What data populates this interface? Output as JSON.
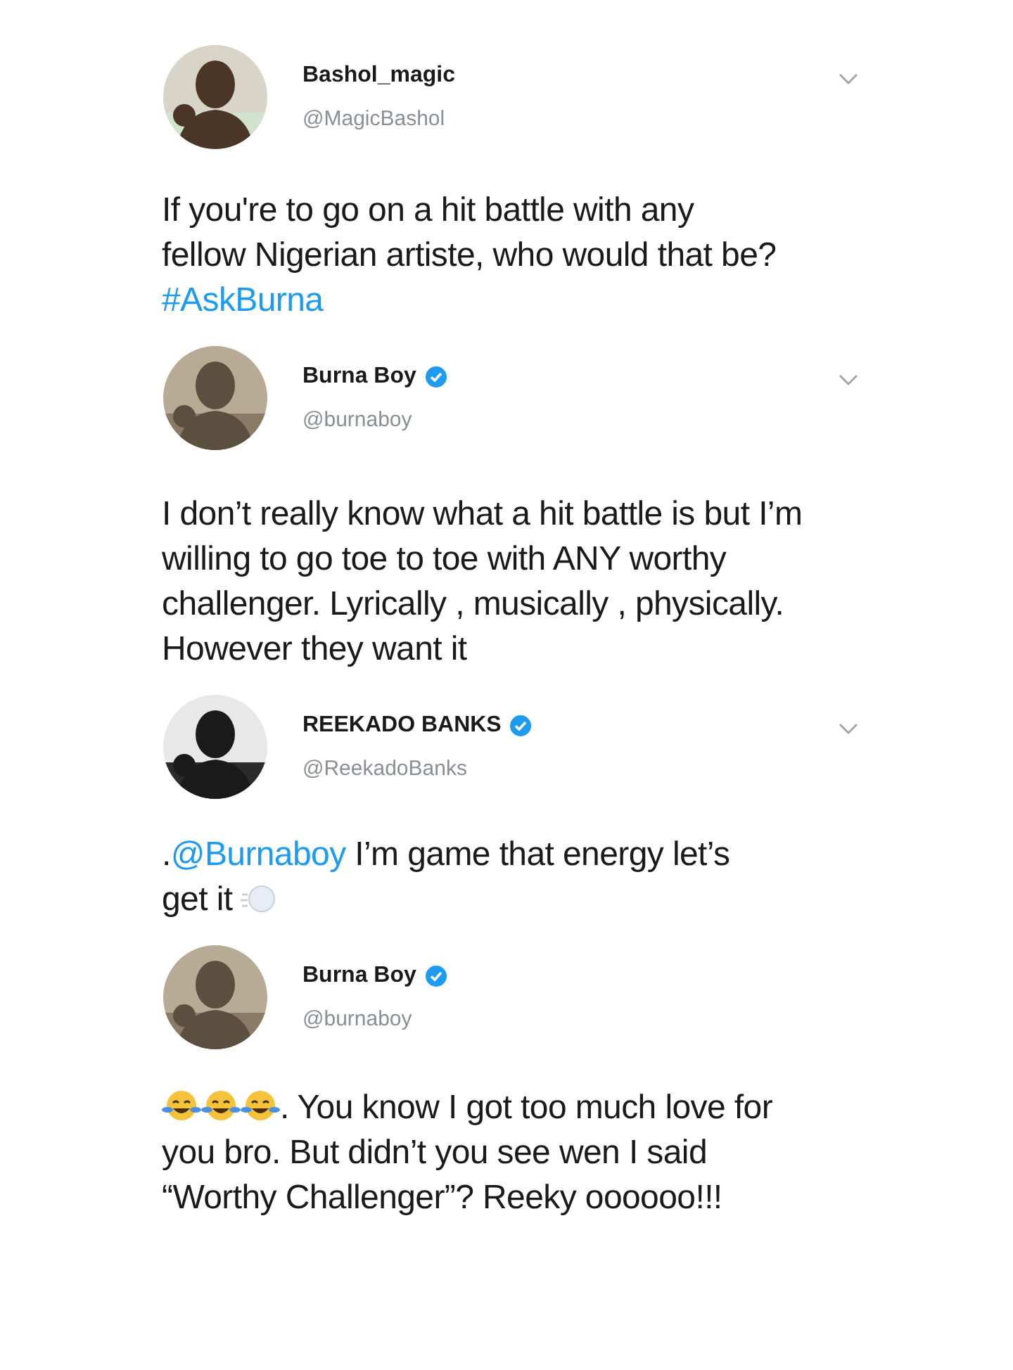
{
  "tweets": [
    {
      "name": "Bashol_magic",
      "handle": "@MagicBashol",
      "verified": false,
      "parts": [
        {
          "kind": "text",
          "text": "If you're to go on a hit battle with any fellow Nigerian artiste, who would that be? "
        },
        {
          "kind": "link",
          "text": "#AskBurna"
        }
      ]
    },
    {
      "name": "Burna Boy",
      "handle": "@burnaboy",
      "verified": true,
      "parts": [
        {
          "kind": "text",
          "text": "I don’t really know what a hit battle is but I’m willing to go toe to toe with ANY worthy challenger. Lyrically , musically , physically. However they want it"
        }
      ]
    },
    {
      "name": "REEKADO BANKS",
      "handle": "@ReekadoBanks",
      "verified": true,
      "parts": [
        {
          "kind": "text",
          "text": "."
        },
        {
          "kind": "link",
          "text": "@Burnaboy"
        },
        {
          "kind": "text",
          "text": " I’m game that energy let’s get it"
        },
        {
          "kind": "puff"
        }
      ]
    },
    {
      "name": "Burna Boy",
      "handle": "@burnaboy",
      "verified": true,
      "parts": [
        {
          "kind": "laugh"
        },
        {
          "kind": "laugh"
        },
        {
          "kind": "laugh"
        },
        {
          "kind": "text",
          "text": ". You know I got too much love for you bro. But didn’t you see wen I said “Worthy Challenger”? Reeky oooooo!!!"
        }
      ]
    }
  ]
}
